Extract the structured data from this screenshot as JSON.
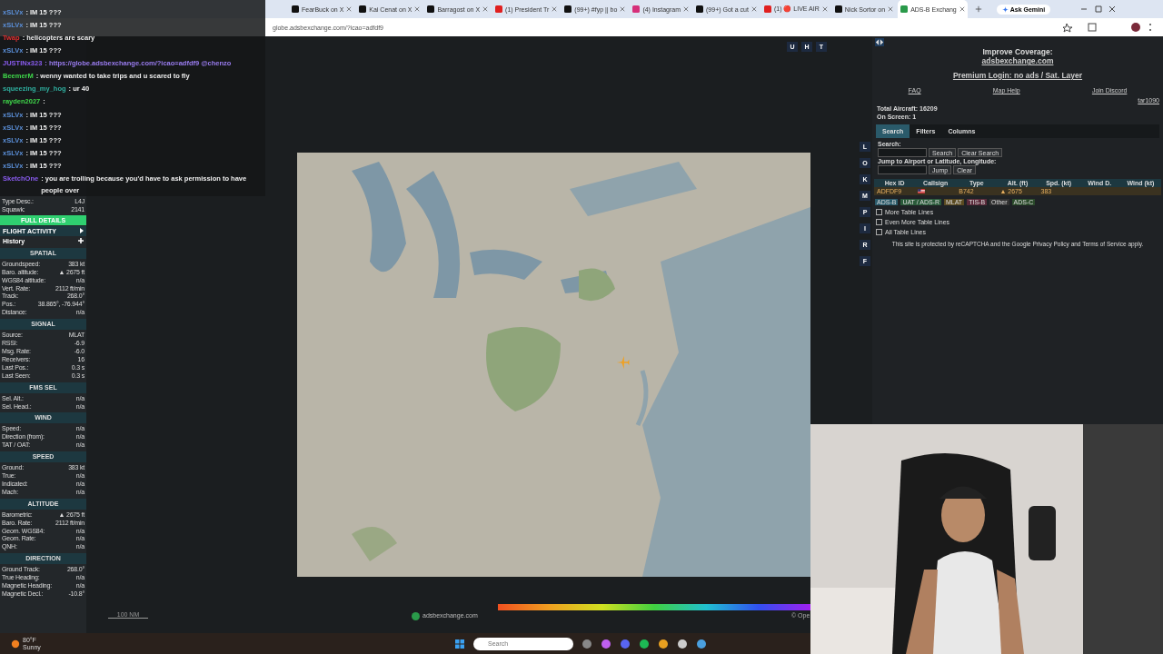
{
  "browser": {
    "tabs": [
      {
        "kind": "x",
        "label": "FearBuck on X",
        "selected": false
      },
      {
        "kind": "x",
        "label": "Kai Cenat on X",
        "selected": false
      },
      {
        "kind": "x",
        "label": "Barragost on X",
        "selected": false
      },
      {
        "kind": "youtube",
        "label": "(1) President Tr",
        "selected": false
      },
      {
        "kind": "tiktok",
        "label": "(99+) #fyp || bo",
        "selected": false
      },
      {
        "kind": "instagram",
        "label": "(4) Instagram",
        "selected": false
      },
      {
        "kind": "tiktok",
        "label": "(99+) Got a cut",
        "selected": false
      },
      {
        "kind": "youtube",
        "label": "(1) 🔴 LIVE AIR",
        "selected": false
      },
      {
        "kind": "x",
        "label": "Nick Sortor on",
        "selected": false
      },
      {
        "kind": "adsb",
        "label": "ADS-B Exchang",
        "selected": true
      }
    ],
    "gemini": "Ask Gemini",
    "url": "globe.adsbexchange.com/?icao=adfdf9"
  },
  "chat": [
    {
      "user": "xSLVx",
      "color": "#5b8fd8",
      "text": ": IM 15 ???",
      "link": false
    },
    {
      "user": "xSLVx",
      "color": "#5b8fd8",
      "text": ": IM 15 ???",
      "link": false
    },
    {
      "user": "Twap",
      "color": "#e03030",
      "text": ": helicopters are scary",
      "link": false
    },
    {
      "user": "xSLVx",
      "color": "#5b8fd8",
      "text": ": IM 15 ???",
      "link": false
    },
    {
      "user": "JUSTINx323",
      "color": "#8a5cf0",
      "text": ": https://globe.adsbexchange.com/?icao=adfdf9 @chenzo",
      "link": true
    },
    {
      "user": "BeemerM",
      "color": "#3fd84a",
      "text": ": wenny wanted to take trips and u scared to fly",
      "link": false
    },
    {
      "user": "squeezing_my_hog",
      "color": "#2fb0a0",
      "text": ": ur 40",
      "link": false
    },
    {
      "user": "rayden2027",
      "color": "#3fd84a",
      "text": ":"
    },
    {
      "user": "xSLVx",
      "color": "#5b8fd8",
      "text": ": IM 15 ???",
      "link": false
    },
    {
      "user": "xSLVx",
      "color": "#5b8fd8",
      "text": ": IM 15 ???",
      "link": false
    },
    {
      "user": "xSLVx",
      "color": "#5b8fd8",
      "text": ": IM 15 ???",
      "link": false
    },
    {
      "user": "xSLVx",
      "color": "#5b8fd8",
      "text": ": IM 15 ???",
      "link": false
    },
    {
      "user": "xSLVx",
      "color": "#5b8fd8",
      "text": ": IM 15 ???",
      "link": false
    },
    {
      "user": "SketchOne",
      "color": "#8a5cf0",
      "text": ": you are trolling because you'd have to ask permission to have people over",
      "link": false
    }
  ],
  "aircraft": {
    "top_rows": [
      {
        "label": "Type Desc.:",
        "value": "L4J"
      },
      {
        "label": "Squawk:",
        "value": "2141"
      }
    ],
    "full_details": "FULL DETAILS",
    "flight_activity": "FLIGHT ACTIVITY",
    "history": "History",
    "sections": [
      {
        "title": "SPATIAL",
        "rows": [
          {
            "label": "Groundspeed:",
            "value": "383 kt"
          },
          {
            "label": "Baro. altitude:",
            "value": "▲ 2675 ft"
          },
          {
            "label": "WGS84 altitude:",
            "value": "n/a"
          },
          {
            "label": "Vert. Rate:",
            "value": "2112 ft/min"
          },
          {
            "label": "Track:",
            "value": "268.0°"
          },
          {
            "label": "Pos.:",
            "value": "38.865°, -76.944°"
          },
          {
            "label": "Distance:",
            "value": "n/a"
          }
        ]
      },
      {
        "title": "SIGNAL",
        "rows": [
          {
            "label": "Source:",
            "value": "MLAT"
          },
          {
            "label": "RSSI:",
            "value": "-6.9"
          },
          {
            "label": "Msg. Rate:",
            "value": "-6.0"
          },
          {
            "label": "Receivers:",
            "value": "16"
          },
          {
            "label": "Last Pos.:",
            "value": "0.3 s"
          },
          {
            "label": "Last Seen:",
            "value": "0.3 s"
          }
        ]
      },
      {
        "title": "FMS SEL",
        "rows": [
          {
            "label": "Sel. Alt.:",
            "value": "n/a"
          },
          {
            "label": "Sel. Head.:",
            "value": "n/a"
          }
        ]
      },
      {
        "title": "WIND",
        "rows": [
          {
            "label": "Speed:",
            "value": "n/a"
          },
          {
            "label": "Direction (from):",
            "value": "n/a"
          },
          {
            "label": "TAT / OAT:",
            "value": "n/a"
          }
        ]
      },
      {
        "title": "SPEED",
        "rows": [
          {
            "label": "Ground:",
            "value": "383 kt"
          },
          {
            "label": "True:",
            "value": "n/a"
          },
          {
            "label": "Indicated:",
            "value": "n/a"
          },
          {
            "label": "Mach:",
            "value": "n/a"
          }
        ]
      },
      {
        "title": "ALTITUDE",
        "rows": [
          {
            "label": "Barometric:",
            "value": "▲ 2675 ft"
          },
          {
            "label": "Baro. Rate:",
            "value": "2112 ft/min"
          },
          {
            "label": "Geom. WGS84:",
            "value": "n/a"
          },
          {
            "label": "Geom. Rate:",
            "value": "n/a"
          },
          {
            "label": "QNH:",
            "value": "n/a"
          }
        ]
      },
      {
        "title": "DIRECTION",
        "rows": [
          {
            "label": "Ground Track:",
            "value": "268.0°"
          },
          {
            "label": "True Heading:",
            "value": "n/a"
          },
          {
            "label": "Magnetic Heading:",
            "value": "n/a"
          },
          {
            "label": "Magnetic Decl.:",
            "value": "-10.8°"
          }
        ]
      }
    ]
  },
  "map": {
    "top_buttons": [
      "U",
      "H",
      "T"
    ],
    "side_buttons": [
      "L",
      "O",
      "K",
      "M",
      "P",
      "I",
      "R",
      "F"
    ],
    "scale": "100 NM",
    "logo": "adsbexchange.com",
    "attribution": "© Ope"
  },
  "panel": {
    "coverage": "Improve Coverage:",
    "coverage_link": "adsbexchange.com",
    "premium": "Premium Login: no ads / Sat. Layer",
    "links": [
      "FAQ",
      "Map Help",
      "Join Discord"
    ],
    "user": "tar1090",
    "total": "Total Aircraft: 16209",
    "on_screen": "On Screen: 1",
    "tabs": [
      {
        "label": "Search",
        "selected": true
      },
      {
        "label": "Filters",
        "selected": false
      },
      {
        "label": "Columns",
        "selected": false
      }
    ],
    "search_label": "Search:",
    "search_button": "Search",
    "clear_search": "Clear Search",
    "jump_label": "Jump to Airport or Latitude, Longitude:",
    "jump_button": "Jump",
    "clear_button": "Clear",
    "table": {
      "columns": [
        "Hex ID",
        "Callsign",
        "Type",
        "Alt. (ft)",
        "Spd. (kt)",
        "Wind D.",
        "Wind (kt)"
      ],
      "rows": [
        {
          "hex": "ADFDF9",
          "type": "B742",
          "alt": "▲ 2675",
          "spd": "383",
          "selected": true
        }
      ]
    },
    "legend": [
      {
        "label": "ADS-B",
        "color": "#2a5a6a"
      },
      {
        "label": "UAT / ADS-R",
        "color": "#2a5a3a"
      },
      {
        "label": "MLAT",
        "color": "#5a4a20"
      },
      {
        "label": "TIS-B",
        "color": "#5a2a3a"
      },
      {
        "label": "Other",
        "color": "#333333"
      },
      {
        "label": "ADS-C",
        "color": "#2a4a2a"
      }
    ],
    "options": [
      {
        "label": "More Table Lines",
        "checked": false
      },
      {
        "label": "Even More Table Lines",
        "checked": false
      },
      {
        "label": "All Table Lines",
        "checked": false
      }
    ],
    "captcha": "This site is protected by reCAPTCHA and the Google Privacy Policy and Terms of Service apply."
  },
  "taskbar": {
    "temp": "80°F",
    "weather": "Sunny",
    "search_placeholder": "Search"
  }
}
